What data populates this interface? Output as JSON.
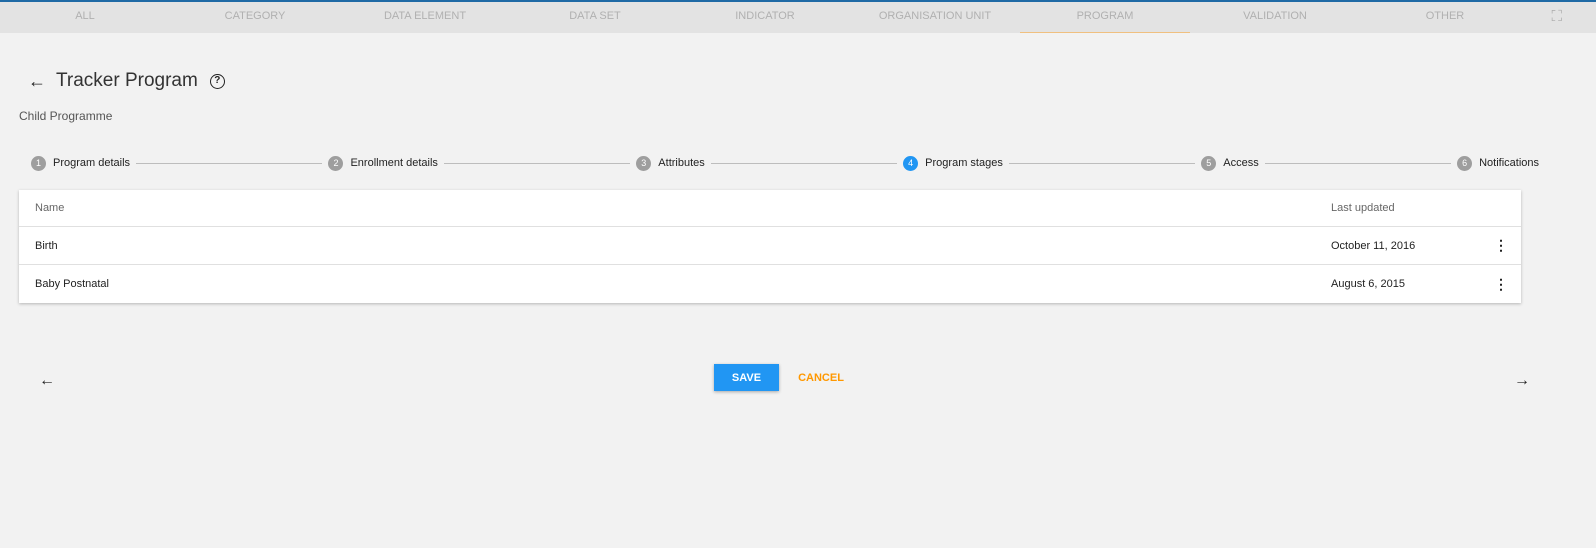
{
  "tabs": [
    "ALL",
    "CATEGORY",
    "DATA ELEMENT",
    "DATA SET",
    "INDICATOR",
    "ORGANISATION UNIT",
    "PROGRAM",
    "VALIDATION",
    "OTHER"
  ],
  "header": {
    "title": "Tracker Program",
    "subtitle": "Child Programme"
  },
  "steps": [
    {
      "n": "1",
      "label": "Program details"
    },
    {
      "n": "2",
      "label": "Enrollment details"
    },
    {
      "n": "3",
      "label": "Attributes"
    },
    {
      "n": "4",
      "label": "Program stages"
    },
    {
      "n": "5",
      "label": "Access"
    },
    {
      "n": "6",
      "label": "Notifications"
    }
  ],
  "table": {
    "columns": [
      "Name",
      "Last updated"
    ],
    "rows": [
      {
        "name": "Birth",
        "updated": "October 11, 2016"
      },
      {
        "name": "Baby Postnatal",
        "updated": "August 6, 2015"
      }
    ]
  },
  "actions": {
    "save": "SAVE",
    "cancel": "CANCEL"
  },
  "colors": {
    "accent": "#2196f3",
    "cancel": "#ff9800"
  }
}
